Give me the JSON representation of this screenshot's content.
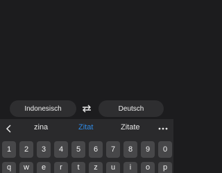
{
  "translator": {
    "source_language": "Indonesisch",
    "target_language": "Deutsch",
    "swap_icon": "swap-arrows-icon"
  },
  "keyboard": {
    "back_icon": "chevron-left-icon",
    "more_icon": "more-dots-icon",
    "suggestions": [
      "zina",
      "Zitat",
      "Zitate"
    ],
    "selected_suggestion": "Zitat",
    "number_keys": [
      "1",
      "2",
      "3",
      "4",
      "5",
      "6",
      "7",
      "8",
      "9",
      "0"
    ],
    "letter_keys": [
      "q",
      "w",
      "e",
      "r",
      "t",
      "z",
      "u",
      "i",
      "o",
      "p"
    ],
    "accent_color": "#2f8be6"
  }
}
